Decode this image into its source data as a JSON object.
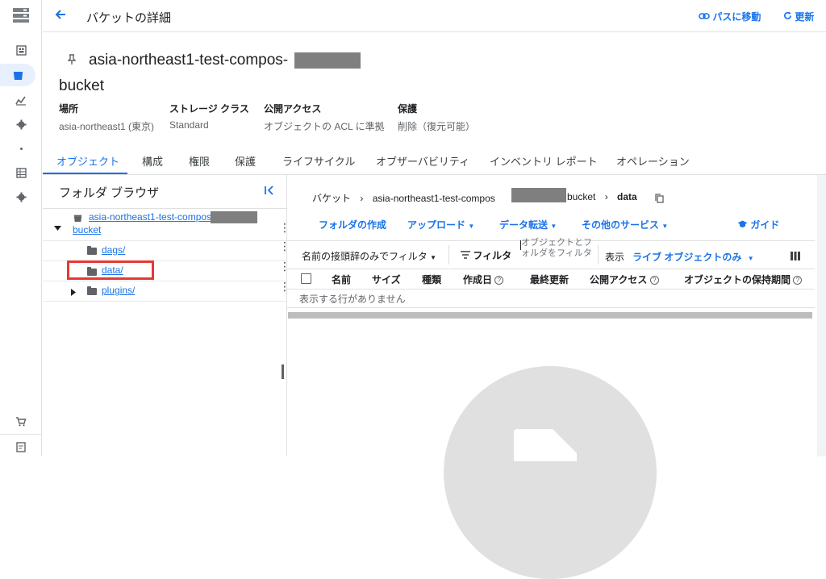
{
  "header": {
    "title": "バケットの詳細",
    "goto_path": "パスに移動",
    "refresh": "更新"
  },
  "bucket": {
    "name_line1": "asia-northeast1-test-compos-",
    "name_line2": "bucket",
    "meta": [
      {
        "label": "場所",
        "value": "asia-northeast1 (東京)"
      },
      {
        "label": "ストレージ クラス",
        "value": "Standard"
      },
      {
        "label": "公開アクセス",
        "value": "オブジェクトの ACL に準拠"
      },
      {
        "label": "保護",
        "value": "削除（復元可能）"
      }
    ]
  },
  "tabs": [
    "オブジェクト",
    "構成",
    "権限",
    "保護",
    "ライフサイクル",
    "オブザーバビリティ",
    "インベントリ レポート",
    "オペレーション"
  ],
  "folder_browser": {
    "title": "フォルダ ブラウザ",
    "root_name_a": "asia-northeast1-test-compos",
    "root_name_b": "bucket",
    "folders": [
      "dags/",
      "data/",
      "plugins/"
    ]
  },
  "breadcrumb": {
    "root": "バケット",
    "bucket_a": "asia-northeast1-test-compos",
    "bucket_b": "bucket",
    "current": "data"
  },
  "toolbar": {
    "create_folder": "フォルダの作成",
    "upload": "アップロード",
    "transfer": "データ転送",
    "other_services": "その他のサービス",
    "guide": "ガイド"
  },
  "filter": {
    "prefix_filter": "名前の接頭辞のみでフィルタ",
    "filter": "フィルタ",
    "filter_placeholder": "オブジェクトとフォルダをフィルタ",
    "view_label": "表示",
    "view_value": "ライブ オブジェクトのみ"
  },
  "table": {
    "columns": [
      "名前",
      "サイズ",
      "種類",
      "作成日",
      "最終更新",
      "公開アクセス",
      "オブジェクトの保持期間"
    ],
    "empty": "表示する行がありません"
  },
  "colors": {
    "accent": "#1a73e8",
    "highlight_border": "#e53935"
  }
}
